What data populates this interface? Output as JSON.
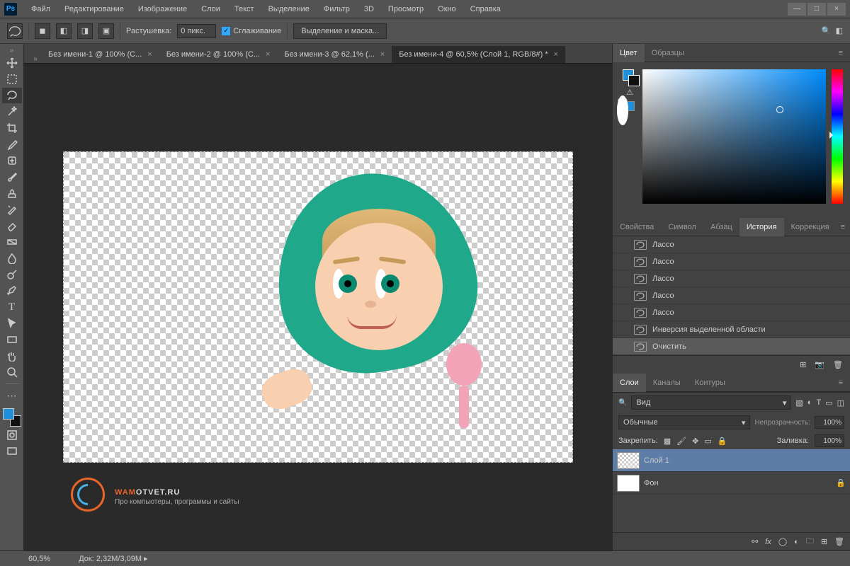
{
  "menu": [
    "Файл",
    "Редактирование",
    "Изображение",
    "Слои",
    "Текст",
    "Выделение",
    "Фильтр",
    "3D",
    "Просмотр",
    "Окно",
    "Справка"
  ],
  "win_controls": {
    "min": "—",
    "max": "□",
    "close": "×"
  },
  "optbar": {
    "feather_label": "Растушевка:",
    "feather_value": "0 пикс.",
    "antialias": "Сглаживание",
    "select_mask": "Выделение и маска..."
  },
  "tabs": {
    "items": [
      {
        "label": "Без имени-1 @ 100% (С..."
      },
      {
        "label": "Без имени-2 @ 100% (С..."
      },
      {
        "label": "Без имени-3 @ 62,1% (..."
      },
      {
        "label": "Без имени-4 @ 60,5% (Слой 1, RGB/8#) *"
      }
    ],
    "active": 3
  },
  "watermark": {
    "brand_a": "WAM",
    "brand_b": "OTVET.RU",
    "tagline": "Про компьютеры, программы и сайты"
  },
  "panels": {
    "color_tabs": [
      "Цвет",
      "Образцы"
    ],
    "mid_tabs": [
      "Свойства",
      "Символ",
      "Абзац",
      "История",
      "Коррекция"
    ],
    "mid_active": 3,
    "history_items": [
      "Лассо",
      "Лассо",
      "Лассо",
      "Лассо",
      "Лассо",
      "Инверсия выделенной области",
      "Очистить"
    ],
    "history_selected": 6,
    "layer_tabs": [
      "Слои",
      "Каналы",
      "Контуры"
    ],
    "layer_filter": "Вид",
    "blend": "Обычные",
    "opacity_label": "Непрозрачность:",
    "opacity": "100%",
    "lock_label": "Закрепить:",
    "fill_label": "Заливка:",
    "fill": "100%",
    "layers": [
      {
        "name": "Слой 1",
        "visible": true,
        "sel": true
      },
      {
        "name": "Фон",
        "visible": false,
        "locked": true
      }
    ]
  },
  "status": {
    "zoom": "60,5%",
    "doc_label": "Док:",
    "doc": "2,32M/3,09M"
  },
  "colors": {
    "fg": "#1e8fd8",
    "bg": "#111111"
  }
}
